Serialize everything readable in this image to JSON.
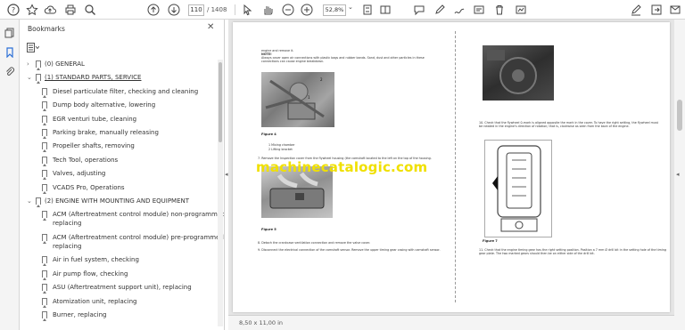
{
  "toolbar": {
    "current_page": "110",
    "page_total": "/ 1408",
    "zoom": "52,8%"
  },
  "panel": {
    "title": "Bookmarks"
  },
  "bookmarks": [
    {
      "label": "(0) GENERAL",
      "level": 0,
      "arrow": "›"
    },
    {
      "label": "(1) STANDARD PARTS, SERVICE",
      "level": 0,
      "arrow": "⌄"
    },
    {
      "label": "Diesel particulate filter, checking and cleaning",
      "level": 1
    },
    {
      "label": "Dump body alternative, lowering",
      "level": 1
    },
    {
      "label": "EGR venturi tube, cleaning",
      "level": 1
    },
    {
      "label": "Parking brake, manually releasing",
      "level": 1
    },
    {
      "label": "Propeller shafts, removing",
      "level": 1
    },
    {
      "label": "Tech Tool, operations",
      "level": 1
    },
    {
      "label": "Valves, adjusting",
      "level": 1
    },
    {
      "label": "VCADS Pro, Operations",
      "level": 1
    },
    {
      "label": "(2) ENGINE WITH MOUNTING AND EQUIPMENT",
      "level": 0,
      "arrow": "⌄"
    },
    {
      "label": "ACM (Aftertreatment control module) non-programmed,",
      "label2": "replacing",
      "level": 1
    },
    {
      "label": "ACM (Aftertreatment control module) pre-programmed,",
      "label2": "replacing",
      "level": 1
    },
    {
      "label": "Air in fuel system, checking",
      "level": 1
    },
    {
      "label": "Air pump flow, checking",
      "level": 1
    },
    {
      "label": "ASU (Aftertreatment support unit), replacing",
      "level": 1
    },
    {
      "label": "Atomization unit, replacing",
      "level": 1
    },
    {
      "label": "Burner, replacing",
      "level": 1
    }
  ],
  "document": {
    "left": {
      "intro1": "engine and remove it.",
      "note_title": "NOTE!",
      "note_body": "Always cover open air connections with plastic bags and rubber bands. Sand, dust and other particles in these connections can cause engine breakdown.",
      "fig4": "Figure 4",
      "item1": "1    Mixing chamber",
      "item2": "2    Lifting bracket",
      "step7": "7.   Remove the Inspection cover from the flywheel housing (the camshaft located to the left on the top of the housing.",
      "fig5": "Figure 5",
      "step8": "8.   Detach the crankcase ventilation connection and remove the valve cover.",
      "step9": "9.   Disconnect the electrical connection of the camshaft sensor. Remove the upper timing gear casing with camshaft sensor."
    },
    "right": {
      "step10": "10.  Check that the flywheel 0-mark is aligned opposite the mark in the cover. To have the right setting, the flywheel must be rotated in the engine's direction of rotation; that is, clockwise as seen from the back of the engine.",
      "fig7": "Figure 7",
      "step11": "11.  Check that the engine timing gear has the right setting position. Position a 7 mm Ø drill bit in the setting hole of the timing gear plate. The two marked gears should then be on either side of the drill bit."
    },
    "watermark": "machinecatalogic.com"
  },
  "status": {
    "page_size": "8,50 x 11,00 in"
  }
}
